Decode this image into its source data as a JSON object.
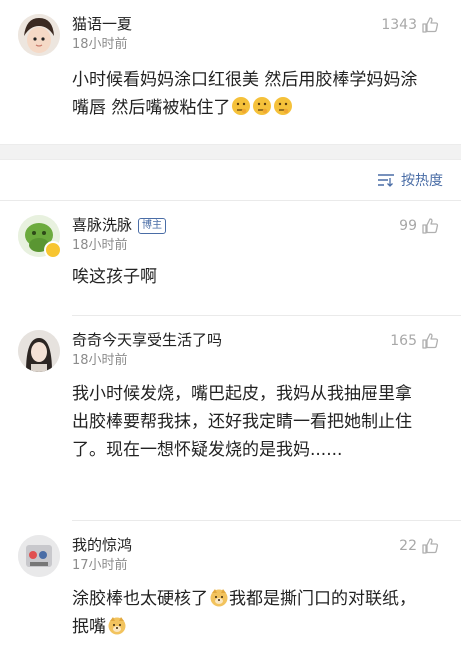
{
  "comments": [
    {
      "username": "猫语一夏",
      "time": "18小时前",
      "likes": "1343",
      "text_parts": [
        "小时候看妈妈涂口红很美 然后用胶棒学妈妈涂嘴唇 然后嘴被粘住了"
      ],
      "emoji_icon": "thinking-face-icon"
    },
    {
      "username": "喜脉洗脉",
      "badge": "博主",
      "time": "18小时前",
      "likes": "99",
      "text_parts": [
        "唉这孩子啊"
      ]
    },
    {
      "username": "奇奇今天享受生活了吗",
      "time": "18小时前",
      "likes": "165",
      "text_parts": [
        "我小时候发烧，嘴巴起皮，我妈从我抽屉里拿出胶棒要帮我抹，还好我定睛一看把她制止住了。现在一想怀疑发烧的是我妈......"
      ]
    },
    {
      "username": "我的惊鸿",
      "time": "17小时前",
      "likes": "22",
      "text_parts": [
        "涂胶棒也太硬核了",
        "我都是撕门口的对联纸，抿嘴"
      ],
      "emoji_icon": "doge-icon"
    }
  ],
  "sort": {
    "label": "按热度",
    "icon": "sort-icon"
  },
  "colors": {
    "link": "#4a6da6",
    "muted": "#8c8c8c",
    "like": "#a8a8a8",
    "emoji": "#f5c13a"
  }
}
